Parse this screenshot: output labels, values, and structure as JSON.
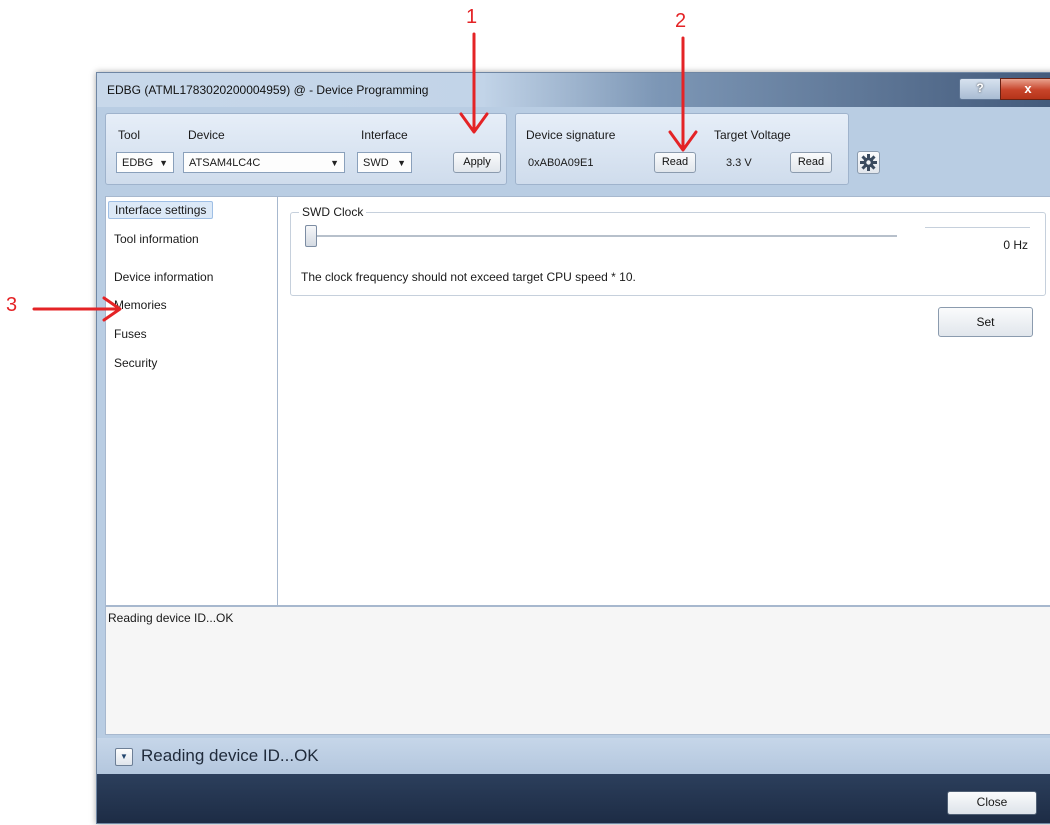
{
  "window": {
    "title": "EDBG (ATML1783020200004959) @  - Device Programming",
    "help_label": "?",
    "close_glyph": "x"
  },
  "toolbar": {
    "tool_label": "Tool",
    "tool_value": "EDBG",
    "device_label": "Device",
    "device_value": "ATSAM4LC4C",
    "interface_label": "Interface",
    "interface_value": "SWD",
    "apply_label": "Apply",
    "signature_label": "Device signature",
    "signature_value": "0xAB0A09E1",
    "signature_read_label": "Read",
    "voltage_label": "Target Voltage",
    "voltage_value": "3.3 V",
    "voltage_read_label": "Read",
    "settings_icon": "gear-icon"
  },
  "sidebar": {
    "items": [
      {
        "label": "Interface settings",
        "selected": true
      },
      {
        "label": "Tool information"
      },
      {
        "label": "Device information"
      },
      {
        "label": "Memories"
      },
      {
        "label": "Fuses"
      },
      {
        "label": "Security"
      }
    ]
  },
  "main": {
    "group_label": "SWD Clock",
    "clock_value": "0 Hz",
    "hint": "The clock frequency should not exceed target CPU speed * 10.",
    "set_label": "Set"
  },
  "log": {
    "text": "Reading device ID...OK"
  },
  "status": {
    "text": "Reading device ID...OK"
  },
  "footer": {
    "close_label": "Close"
  },
  "annotations": {
    "labels": [
      "1",
      "2",
      "3"
    ],
    "color": "#e42326"
  }
}
